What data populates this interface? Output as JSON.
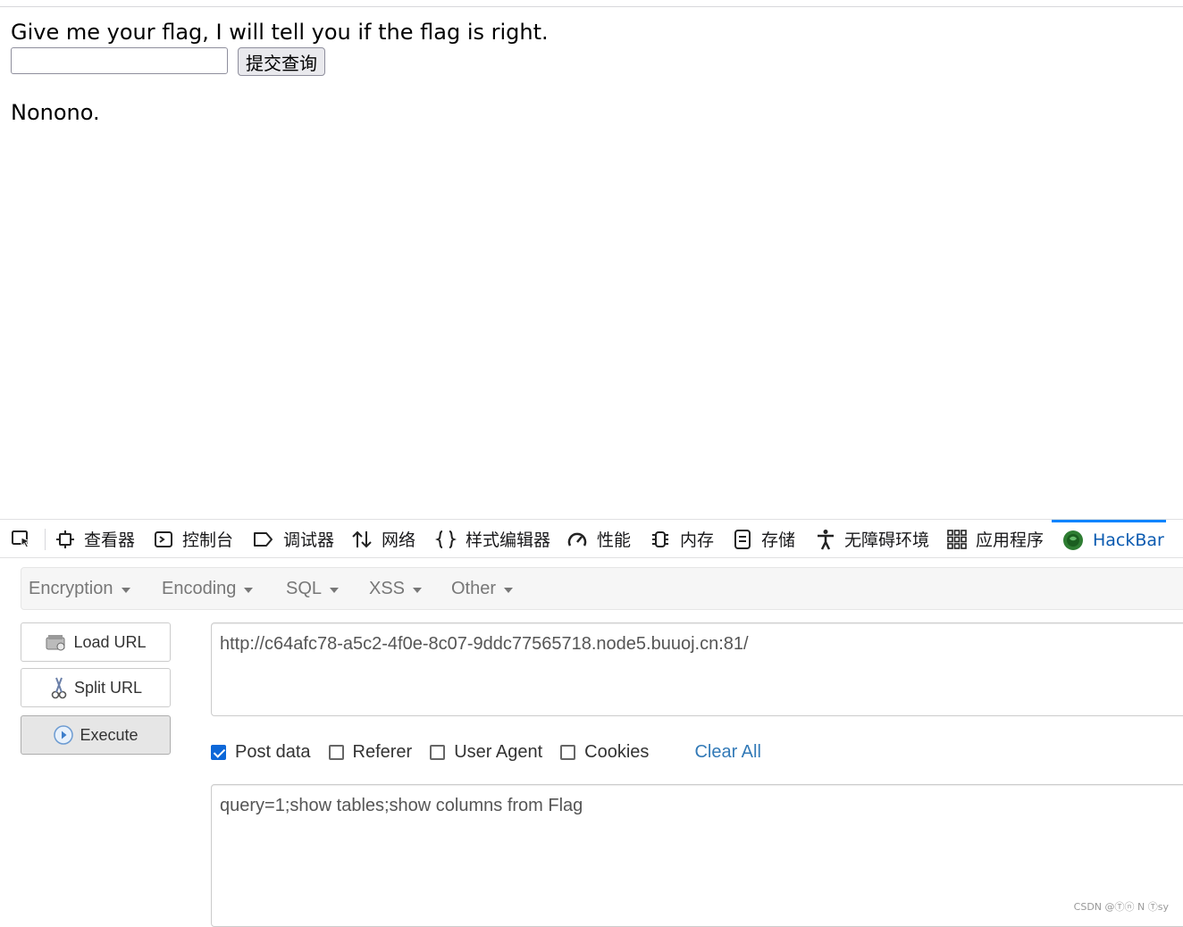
{
  "page": {
    "prompt": "Give me your flag, I will tell you if the flag is right.",
    "input_value": "",
    "submit_label": "提交查询",
    "result_text": "Nonono."
  },
  "devtools": {
    "tabs": [
      {
        "label": "查看器",
        "icon": "inspector-icon"
      },
      {
        "label": "控制台",
        "icon": "console-icon"
      },
      {
        "label": "调试器",
        "icon": "debugger-icon"
      },
      {
        "label": "网络",
        "icon": "network-icon"
      },
      {
        "label": "样式编辑器",
        "icon": "style-editor-icon"
      },
      {
        "label": "性能",
        "icon": "performance-icon"
      },
      {
        "label": "内存",
        "icon": "memory-icon"
      },
      {
        "label": "存储",
        "icon": "storage-icon"
      },
      {
        "label": "无障碍环境",
        "icon": "accessibility-icon"
      },
      {
        "label": "应用程序",
        "icon": "application-icon"
      },
      {
        "label": "HackBar",
        "icon": "hackbar-icon",
        "active": true
      }
    ]
  },
  "hackbar": {
    "menus": [
      {
        "label": "Encryption"
      },
      {
        "label": "Encoding"
      },
      {
        "label": "SQL"
      },
      {
        "label": "XSS"
      },
      {
        "label": "Other"
      }
    ],
    "load_url_label": "Load URL",
    "split_url_label": "Split URL",
    "execute_label": "Execute",
    "url_value": "http://c64afc78-a5c2-4f0e-8c07-9ddc77565718.node5.buuoj.cn:81/",
    "options": {
      "post_data": {
        "label": "Post data",
        "checked": true
      },
      "referer": {
        "label": "Referer",
        "checked": false
      },
      "user_agent": {
        "label": "User Agent",
        "checked": false
      },
      "cookies": {
        "label": "Cookies",
        "checked": false
      }
    },
    "clear_all_label": "Clear All",
    "post_value": "query=1;show tables;show columns from Flag"
  },
  "watermark": "CSDN @Ⓣⓝ N Ⓣsy",
  "colors": {
    "active_tab": "#0a5ab0",
    "active_tab_border": "#0a84ff",
    "checkbox_checked": "#0c67d8",
    "link": "#337ab7"
  }
}
